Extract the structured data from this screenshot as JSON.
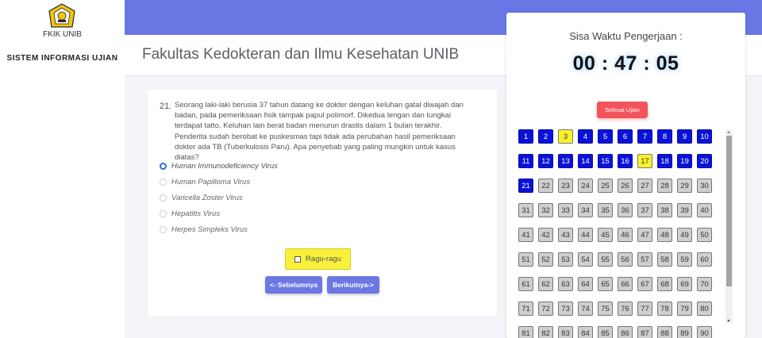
{
  "sidebar": {
    "logo_text": "FKIK UNIB",
    "title": "SISTEM INFORMASI UJIAN"
  },
  "header": {
    "title": "Fakultas Kedokteran dan Ilmu Kesehatan UNIB"
  },
  "question": {
    "number": "21.",
    "text": "Seorang laki-laki berusia 37 tahun datang ke dokter dengan keluhan gatal diwajah dan badan, pada pemeriksaan fisik tampak papul polimorf. Dikedua lengan dan tungkai terdapat tatto. Keluhan lain berat badan menurun drastis dalam 1 bulan terakhir. Penderita sudah berobat ke puskesmas tapi tidak ada perubahan hasil pemeriksaan dokter ada TB (Tuberkulosis Paru). Apa penyebab yang paling mungkin untuk kasus diatas?",
    "options": [
      {
        "label": "Human Immunodeficiency Virus",
        "selected": true
      },
      {
        "label": "Human Papilloma Virus",
        "selected": false
      },
      {
        "label": "Varicella Zoster Virus",
        "selected": false
      },
      {
        "label": "Hepatitis Virus",
        "selected": false
      },
      {
        "label": "Herpes Simpleks Virus",
        "selected": false
      }
    ],
    "doubt_label": "Ragu-ragu",
    "doubt_checked": false,
    "prev_label": "<- Sebelumnya",
    "next_label": "Berikutnya->"
  },
  "timer": {
    "label": "Sisa Waktu Pengerjaan :",
    "value": "00 : 47 : 05",
    "finish_label": "Selesai Ujian"
  },
  "question_grid": {
    "visible_count": 80,
    "answered": [
      1,
      2,
      4,
      5,
      6,
      7,
      8,
      9,
      10,
      11,
      12,
      13,
      14,
      15,
      16,
      18,
      19,
      20,
      21
    ],
    "doubt": [
      3,
      17
    ],
    "colors": {
      "answered": "#0a12d8",
      "doubt": "#f9f12a",
      "empty": "#cfcfcf"
    }
  },
  "colors": {
    "header_blue": "#6877e3",
    "nav_button": "#6b78e4",
    "finish_button": "#f2545b",
    "doubt_box": "#f8f03a",
    "radio_checked": "#2a70d6"
  }
}
